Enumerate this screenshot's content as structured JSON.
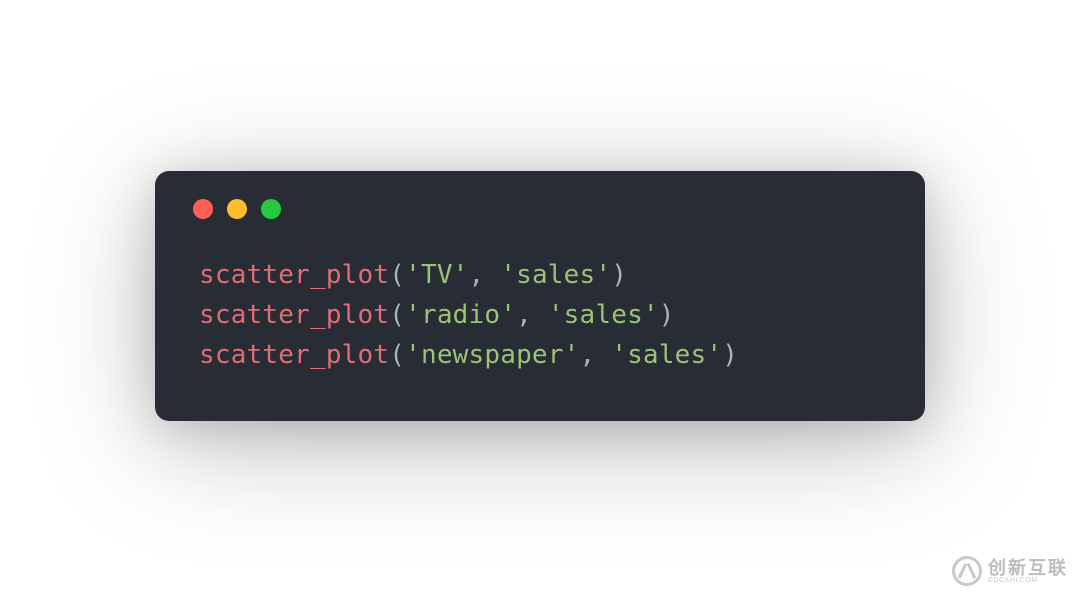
{
  "code": {
    "lines": [
      {
        "fn": "scatter_plot",
        "args": [
          "'TV'",
          "'sales'"
        ]
      },
      {
        "fn": "scatter_plot",
        "args": [
          "'radio'",
          "'sales'"
        ]
      },
      {
        "fn": "scatter_plot",
        "args": [
          "'newspaper'",
          "'sales'"
        ]
      }
    ]
  },
  "watermark": {
    "main": "创新互联",
    "sub": "CDCXHLCOM"
  }
}
